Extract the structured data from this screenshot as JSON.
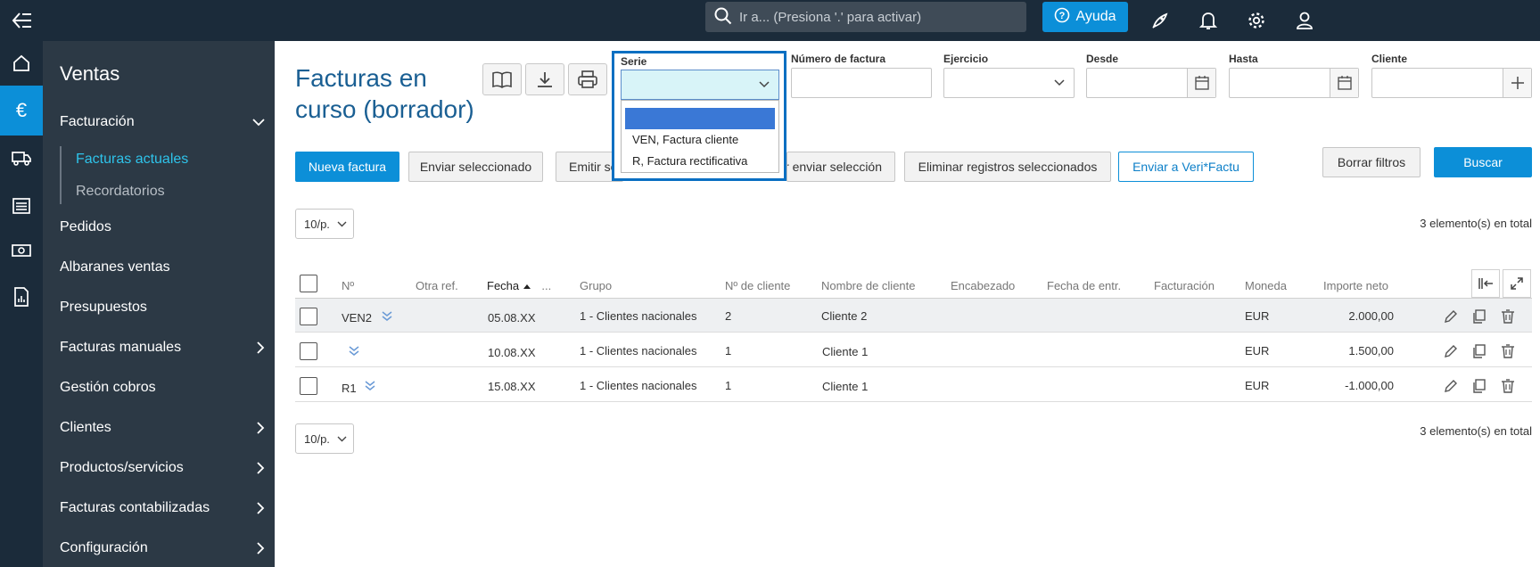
{
  "topbar": {
    "search_placeholder": "Ir a... (Presiona '.' para activar)",
    "help_label": "Ayuda"
  },
  "sidebar": {
    "title": "Ventas",
    "items": [
      {
        "label": "Facturación"
      },
      {
        "label": "Pedidos"
      },
      {
        "label": "Albaranes ventas"
      },
      {
        "label": "Presupuestos"
      },
      {
        "label": "Facturas manuales"
      },
      {
        "label": "Gestión cobros"
      },
      {
        "label": "Clientes"
      },
      {
        "label": "Productos/servicios"
      },
      {
        "label": "Facturas contabilizadas"
      },
      {
        "label": "Configuración"
      }
    ],
    "subitems": [
      {
        "label": "Facturas actuales"
      },
      {
        "label": "Recordatorios"
      }
    ]
  },
  "main": {
    "title_line1": "Facturas en",
    "title_line2": "curso (borrador)"
  },
  "filters": {
    "serie": "Serie",
    "numero": "Número de factura",
    "ejercicio": "Ejercicio",
    "desde": "Desde",
    "hasta": "Hasta",
    "cliente": "Cliente",
    "serie_options": [
      "",
      "VEN, Factura cliente",
      "R, Factura rectificativa"
    ]
  },
  "actions": {
    "nueva": "Nueva factura",
    "enviar": "Enviar seleccionado",
    "emitir": "Emitir se",
    "enviar_sel": "r enviar selección",
    "eliminar": "Eliminar registros seleccionados",
    "verifactu": "Enviar a Veri*Factu",
    "borrar": "Borrar filtros",
    "buscar": "Buscar"
  },
  "pager": {
    "label": "10/p.",
    "total": "3 elemento(s) en total"
  },
  "table": {
    "headers": {
      "num": "Nº",
      "otra": "Otra ref.",
      "fecha": "Fecha",
      "more": "...",
      "grupo": "Grupo",
      "ncliente": "Nº de cliente",
      "nombre": "Nombre de cliente",
      "encabezado": "Encabezado",
      "fechaentr": "Fecha de entr.",
      "facturacion": "Facturación",
      "moneda": "Moneda",
      "importe": "Importe neto"
    },
    "rows": [
      {
        "num": "VEN2",
        "fecha": "05.08.XX",
        "grupo": "1 - Clientes nacionales",
        "ncliente": "2",
        "nombre": "Cliente 2",
        "moneda": "EUR",
        "importe": "2.000,00"
      },
      {
        "num": "",
        "fecha": "10.08.XX",
        "grupo": "1 - Clientes nacionales",
        "ncliente": "1",
        "nombre": "Cliente 1",
        "moneda": "EUR",
        "importe": "1.500,00"
      },
      {
        "num": "R1",
        "fecha": "15.08.XX",
        "grupo": "1 - Clientes nacionales",
        "ncliente": "1",
        "nombre": "Cliente 1",
        "moneda": "EUR",
        "importe": "-1.000,00"
      }
    ]
  },
  "colors": {
    "accent": "#0c8fd8",
    "nav_bg": "#1b2b3a",
    "sidebar_bg": "#2c3945",
    "title": "#1a5f93"
  }
}
